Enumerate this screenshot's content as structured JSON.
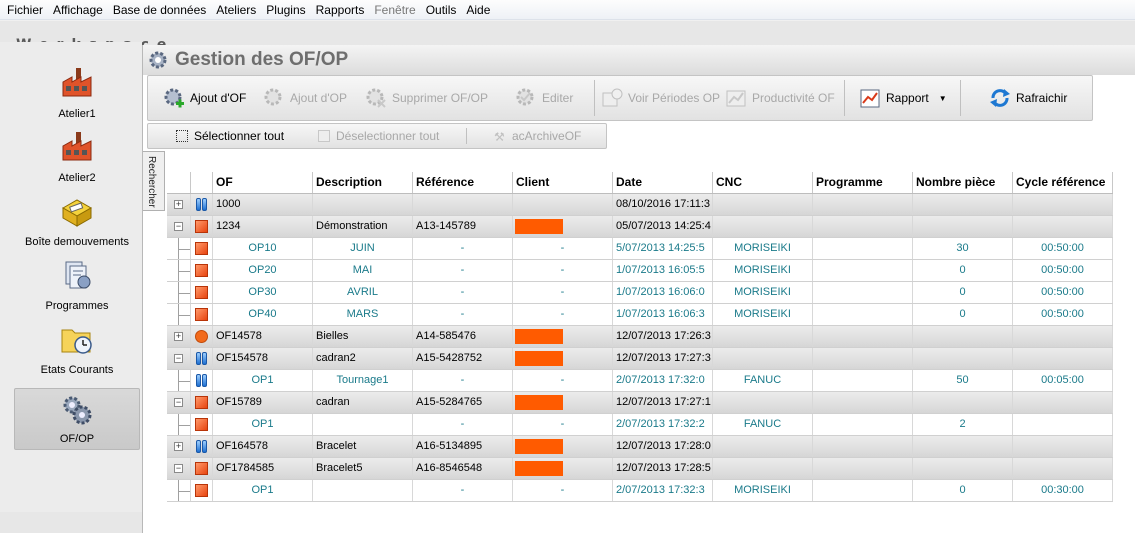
{
  "menu": [
    "Fichier",
    "Affichage",
    "Base de données",
    "Ateliers",
    "Plugins",
    "Rapports",
    "Fenêtre",
    "Outils",
    "Aide"
  ],
  "workspace_title": "Workspace",
  "nav": [
    {
      "label": "Atelier1",
      "icon": "factory-icon"
    },
    {
      "label": "Atelier2",
      "icon": "factory-icon"
    },
    {
      "label": "Boîte demouvements",
      "icon": "box-icon"
    },
    {
      "label": "Programmes",
      "icon": "programs-icon"
    },
    {
      "label": "Etats Courants",
      "icon": "folder-clock-icon"
    },
    {
      "label": "OF/OP",
      "icon": "gears-icon"
    }
  ],
  "main_title": "Gestion des OF/OP",
  "toolbar": {
    "ajout_of": "Ajout d'OF",
    "ajout_op": "Ajout d'OP",
    "supprimer": "Supprimer OF/OP",
    "editer": "Editer",
    "voir_periodes": "Voir Périodes OP",
    "productivite": "Productivité OF",
    "rapport": "Rapport",
    "rafraichir": "Rafraichir"
  },
  "toolbar2": {
    "select_all": "Sélectionner tout",
    "deselect_all": "Déselectionner tout",
    "archive": "acArchiveOF"
  },
  "search_tab": "Rechercher",
  "columns": [
    "OF",
    "Description",
    "Référence",
    "Client",
    "Date",
    "CNC",
    "Programme",
    "Nombre pièce",
    "Cycle référence"
  ],
  "rows": [
    {
      "kind": "of",
      "exp": "+",
      "icon": "blue",
      "of": "1000",
      "desc": "",
      "ref": "",
      "client": false,
      "date": "08/10/2016 17:11:3",
      "cnc": "",
      "prog": "",
      "nb": "",
      "cycle": ""
    },
    {
      "kind": "of",
      "exp": "−",
      "icon": "red",
      "of": "1234",
      "desc": "Démonstration",
      "ref": "A13-145789",
      "client": true,
      "date": "05/07/2013 14:25:4",
      "cnc": "",
      "prog": "",
      "nb": "",
      "cycle": ""
    },
    {
      "kind": "op",
      "icon": "red",
      "of": "OP10",
      "desc": "JUIN",
      "ref": "-",
      "clienttxt": "-",
      "date": "5/07/2013 14:25:5",
      "cnc": "MORISEIKI",
      "prog": "",
      "nb": "30",
      "cycle": "00:50:00"
    },
    {
      "kind": "op",
      "icon": "red",
      "of": "OP20",
      "desc": "MAI",
      "ref": "-",
      "clienttxt": "-",
      "date": "1/07/2013 16:05:5",
      "cnc": "MORISEIKI",
      "prog": "",
      "nb": "0",
      "cycle": "00:50:00"
    },
    {
      "kind": "op",
      "icon": "red",
      "of": "OP30",
      "desc": "AVRIL",
      "ref": "-",
      "clienttxt": "-",
      "date": "1/07/2013 16:06:0",
      "cnc": "MORISEIKI",
      "prog": "",
      "nb": "0",
      "cycle": "00:50:00"
    },
    {
      "kind": "op",
      "icon": "red",
      "of": "OP40",
      "desc": "MARS",
      "ref": "-",
      "clienttxt": "-",
      "date": "1/07/2013 16:06:3",
      "cnc": "MORISEIKI",
      "prog": "",
      "nb": "0",
      "cycle": "00:50:00"
    },
    {
      "kind": "of",
      "exp": "+",
      "icon": "arrow",
      "of": "OF14578",
      "desc": "Bielles",
      "ref": "A14-585476",
      "client": true,
      "date": "12/07/2013 17:26:3",
      "cnc": "",
      "prog": "",
      "nb": "",
      "cycle": ""
    },
    {
      "kind": "of",
      "exp": "−",
      "icon": "blue",
      "of": "OF154578",
      "desc": "cadran2",
      "ref": "A15-5428752",
      "client": true,
      "date": "12/07/2013 17:27:3",
      "cnc": "",
      "prog": "",
      "nb": "",
      "cycle": ""
    },
    {
      "kind": "op",
      "icon": "blue",
      "of": "OP1",
      "desc": "Tournage1",
      "ref": "-",
      "clienttxt": "-",
      "date": "2/07/2013 17:32:0",
      "cnc": "FANUC",
      "prog": "",
      "nb": "50",
      "cycle": "00:05:00"
    },
    {
      "kind": "of",
      "exp": "−",
      "icon": "red",
      "of": "OF15789",
      "desc": "cadran",
      "ref": "A15-5284765",
      "client": true,
      "date": "12/07/2013 17:27:1",
      "cnc": "",
      "prog": "",
      "nb": "",
      "cycle": ""
    },
    {
      "kind": "op",
      "icon": "red",
      "of": "OP1",
      "desc": "",
      "ref": "-",
      "clienttxt": "-",
      "date": "2/07/2013 17:32:2",
      "cnc": "FANUC",
      "prog": "",
      "nb": "2",
      "cycle": ""
    },
    {
      "kind": "of",
      "exp": "+",
      "icon": "blue",
      "of": "OF164578",
      "desc": "Bracelet",
      "ref": "A16-5134895",
      "client": true,
      "date": "12/07/2013 17:28:0",
      "cnc": "",
      "prog": "",
      "nb": "",
      "cycle": ""
    },
    {
      "kind": "of",
      "exp": "−",
      "icon": "red",
      "of": "OF1784585",
      "desc": "Bracelet5",
      "ref": "A16-8546548",
      "client": true,
      "date": "12/07/2013 17:28:5",
      "cnc": "",
      "prog": "",
      "nb": "",
      "cycle": ""
    },
    {
      "kind": "op",
      "icon": "red",
      "of": "OP1",
      "desc": "",
      "ref": "-",
      "clienttxt": "-",
      "date": "2/07/2013 17:32:3",
      "cnc": "MORISEIKI",
      "prog": "",
      "nb": "0",
      "cycle": "00:30:00"
    }
  ],
  "colors": {
    "client_redacted": "#ff5b00",
    "op_text": "#1a7a8a"
  }
}
